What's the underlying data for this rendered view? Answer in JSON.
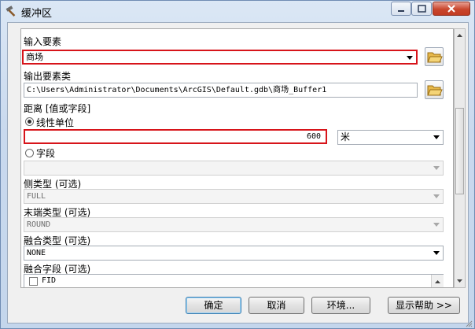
{
  "window": {
    "title": "缓冲区"
  },
  "form": {
    "input_features_label": "输入要素",
    "input_features_value": "商场",
    "output_features_label": "输出要素类",
    "output_features_value": "C:\\Users\\Administrator\\Documents\\ArcGIS\\Default.gdb\\商场_Buffer1",
    "distance_label": "距离 [值或字段]",
    "linear_unit_label": "线性单位",
    "distance_value": "600",
    "unit_value": "米",
    "field_label": "字段",
    "field_value": "",
    "side_type_label": "侧类型 (可选)",
    "side_type_value": "FULL",
    "end_type_label": "末端类型 (可选)",
    "end_type_value": "ROUND",
    "dissolve_type_label": "融合类型 (可选)",
    "dissolve_type_value": "NONE",
    "dissolve_field_label": "融合字段 (可选)",
    "dissolve_fields": [
      "FID"
    ]
  },
  "buttons": {
    "ok": "确定",
    "cancel": "取消",
    "environments": "环境...",
    "show_help": "显示帮助 >>"
  },
  "colors": {
    "highlight_border": "#d7141a"
  }
}
